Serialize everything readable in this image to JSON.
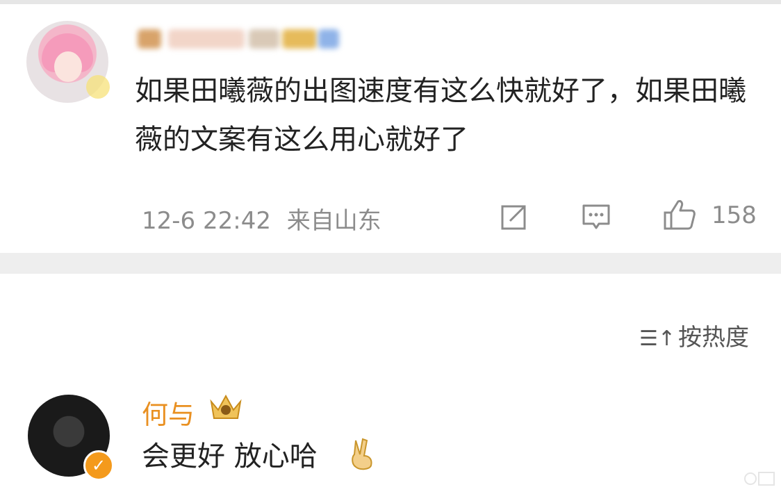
{
  "comment1": {
    "text": "如果田曦薇的出图速度有这么快就好了，如果田曦薇的文案有这么用心就好了",
    "time": "12-6 22:42",
    "location": "来自山东",
    "likes": "158"
  },
  "sort": {
    "label": "按热度",
    "icon": "sort-icon"
  },
  "comment2": {
    "username": "何与",
    "text": "会更好 放心哈"
  },
  "colors": {
    "username_orange": "#e99021",
    "meta_gray": "#8c8c8c",
    "verified_orange": "#f49a1c"
  }
}
